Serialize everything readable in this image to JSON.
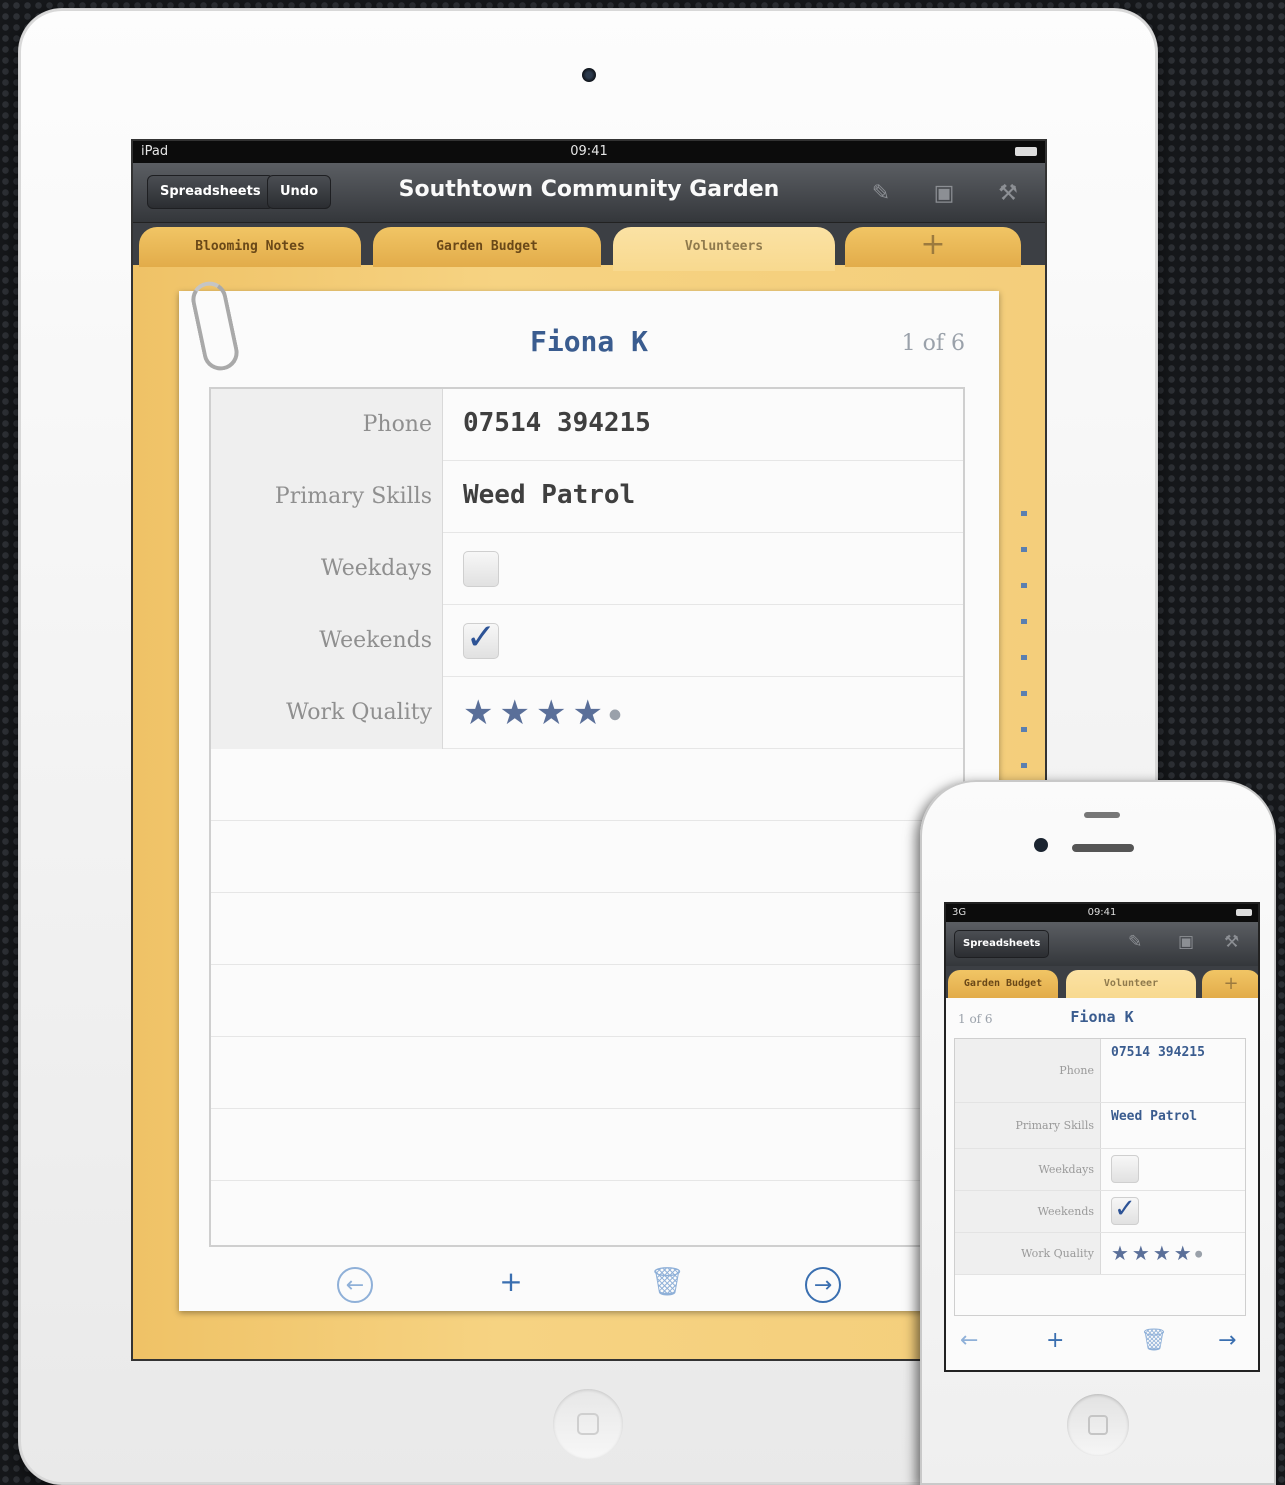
{
  "ipad": {
    "status": {
      "left": "iPad",
      "time": "09:41"
    },
    "nav": {
      "spreadsheets_label": "Spreadsheets",
      "undo_label": "Undo",
      "title": "Southtown Community Garden"
    },
    "tabs": [
      {
        "label": "Blooming Notes",
        "active": false
      },
      {
        "label": "Garden Budget",
        "active": false
      },
      {
        "label": "Volunteers",
        "active": true
      },
      {
        "label": "+",
        "active": false
      }
    ],
    "record": {
      "name": "Fiona K",
      "count": "1 of 6",
      "fields": [
        {
          "label": "Phone",
          "value": "07514 394215",
          "type": "text"
        },
        {
          "label": "Primary Skills",
          "value": "Weed Patrol",
          "type": "text"
        },
        {
          "label": "Weekdays",
          "checked": false,
          "type": "checkbox"
        },
        {
          "label": "Weekends",
          "checked": true,
          "type": "checkbox"
        },
        {
          "label": "Work Quality",
          "rating": 4,
          "max": 5,
          "type": "rating"
        }
      ]
    },
    "toolbar": {
      "prev_icon": "prev-arrow-icon",
      "add_label": "+",
      "trash_icon": "trash-icon",
      "next_icon": "next-arrow-icon"
    }
  },
  "iphone": {
    "status": {
      "left": "3G",
      "time": "09:41"
    },
    "nav": {
      "spreadsheets_label": "Spreadsheets"
    },
    "tabs": [
      {
        "label": "Garden Budget",
        "active": false
      },
      {
        "label": "Volunteer",
        "active": true
      },
      {
        "label": "+",
        "active": false
      }
    ],
    "record": {
      "name": "Fiona K",
      "count": "1 of 6",
      "fields": [
        {
          "label": "Phone",
          "value": "07514 394215"
        },
        {
          "label": "Primary Skills",
          "value": "Weed Patrol"
        },
        {
          "label": "Weekdays",
          "checked": false
        },
        {
          "label": "Weekends",
          "checked": true
        },
        {
          "label": "Work Quality",
          "rating": 4
        }
      ]
    },
    "toolbar": {
      "add_label": "+"
    }
  },
  "colors": {
    "accent": "#3a5c8f",
    "tab": "#f1c565",
    "tab_active": "#fbe2a4",
    "nav": "#3c3f44"
  }
}
